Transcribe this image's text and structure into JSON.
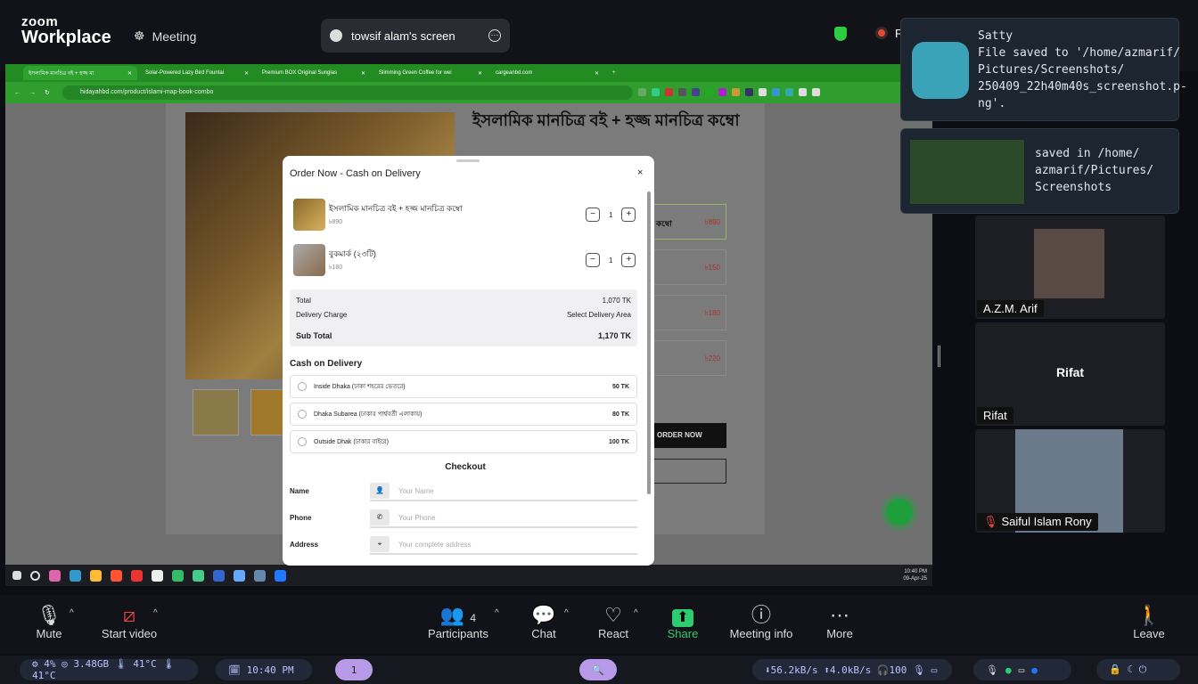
{
  "zoom": {
    "brand_top": "zoom",
    "brand_bottom": "Workplace",
    "meeting_label": "Meeting",
    "share_pill": "towsif alam's screen",
    "right_initial": "F"
  },
  "browser": {
    "tabs": [
      "ইসলামিক মানচিত্র বই + হজ্জ মা",
      "Solar-Powered Lazy Bird Fountai",
      "Premium BOX Original Sunglas",
      "Slimming Green Coffee for wei",
      "cargeanbd.com"
    ],
    "url": "hidayahbd.com/product/islami-map-book-combo"
  },
  "product": {
    "title": "ইসলামিক মানচিত্র বই + হজ্জ মানচিত্র কম্বো",
    "variant_label": "কম্বো",
    "prices": [
      "৳890",
      "৳150",
      "৳180",
      "৳220"
    ],
    "order_now": "ORDER NOW"
  },
  "modal": {
    "title": "Order Now - Cash on Delivery",
    "close": "×",
    "items": [
      {
        "name": "ইসলামিক মানচিত্র বই + হজ্জ মানচিত্র কম্বো",
        "price": "৳890",
        "qty": "1"
      },
      {
        "name": "বুকমার্ক (২৩টি)",
        "price": "৳180",
        "qty": "1"
      }
    ],
    "total_label": "Total",
    "total_value": "1,070 TK",
    "delivery_label": "Delivery Charge",
    "delivery_value": "Select Delivery Area",
    "subtotal_label": "Sub Total",
    "subtotal_value": "1,170 TK",
    "cod_heading": "Cash on Delivery",
    "options": [
      {
        "label": "Inside Dhaka (ঢাকা শহরের ভেতরে)",
        "price": "50 TK"
      },
      {
        "label": "Dhaka Subarea (ঢাকার পার্শ্ববর্তী এলাকায়)",
        "price": "80 TK"
      },
      {
        "label": "Outside Dhak (ঢাকার বাইরে)",
        "price": "100 TK"
      }
    ],
    "checkout": "Checkout",
    "fields": [
      {
        "label": "Name",
        "placeholder": "Your Name"
      },
      {
        "label": "Phone",
        "placeholder": "Your Phone"
      },
      {
        "label": "Address",
        "placeholder": "Your complete address"
      }
    ]
  },
  "taskbar": {
    "time": "10:40 PM",
    "date": "09-Apr-25"
  },
  "notifications": {
    "n1_text": [
      "Satty",
      "File saved to '/home/azmarif/",
      "Pictures/Screenshots/",
      "250409_22h40m40s_screenshot.p-",
      "ng'."
    ],
    "n2_text": [
      "saved in /home/",
      "azmarif/Pictures/",
      "Screenshots"
    ]
  },
  "participants": [
    {
      "name": "A.Z.M. Arif"
    },
    {
      "name": "Rifat",
      "center": "Rifat"
    },
    {
      "name": "Saiful Islam Rony",
      "muted": true
    }
  ],
  "toolbar": {
    "mute": "Mute",
    "video": "Start video",
    "participants": "Participants",
    "participants_count": "4",
    "chat": "Chat",
    "react": "React",
    "share": "Share",
    "info": "Meeting info",
    "more": "More",
    "leave": "Leave"
  },
  "status": {
    "sys": "⚙ 4%  ◎ 3.48GB  🌡 41°C  🌡 41°C",
    "clock": "🗓 10:40 PM",
    "workspace": "1",
    "net": "⬇56.2kB/s ⬆4.0kB/s 🎧100 🎙 ▭"
  }
}
